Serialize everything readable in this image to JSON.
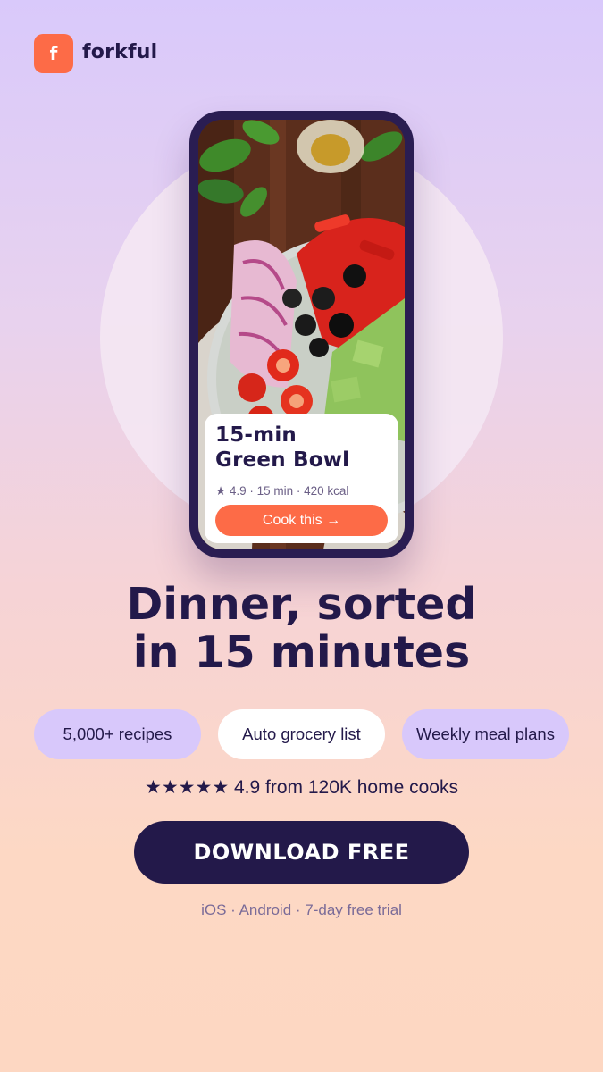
{
  "brand": {
    "logo_letter": "f",
    "name": "forkful",
    "accent": "#fd6b47",
    "dark": "#23194a"
  },
  "phone_mockup": {
    "image_description_icon": "salad-bowl-photo",
    "card": {
      "title": "15-min\nGreen Bowl",
      "meta": "★ 4.9 · 15 min · 420 kcal",
      "cta": "Cook this →"
    }
  },
  "headline": "Dinner, sorted\nin 15 minutes",
  "features": [
    "5,000+ recipes",
    "Auto grocery list",
    "Weekly meal plans"
  ],
  "rating": {
    "stars": "★★★★★",
    "text": "4.9 from 120K home cooks",
    "value": 4.9
  },
  "download": {
    "label": "DOWNLOAD FREE"
  },
  "platforms": "iOS · Android · 7-day free trial"
}
